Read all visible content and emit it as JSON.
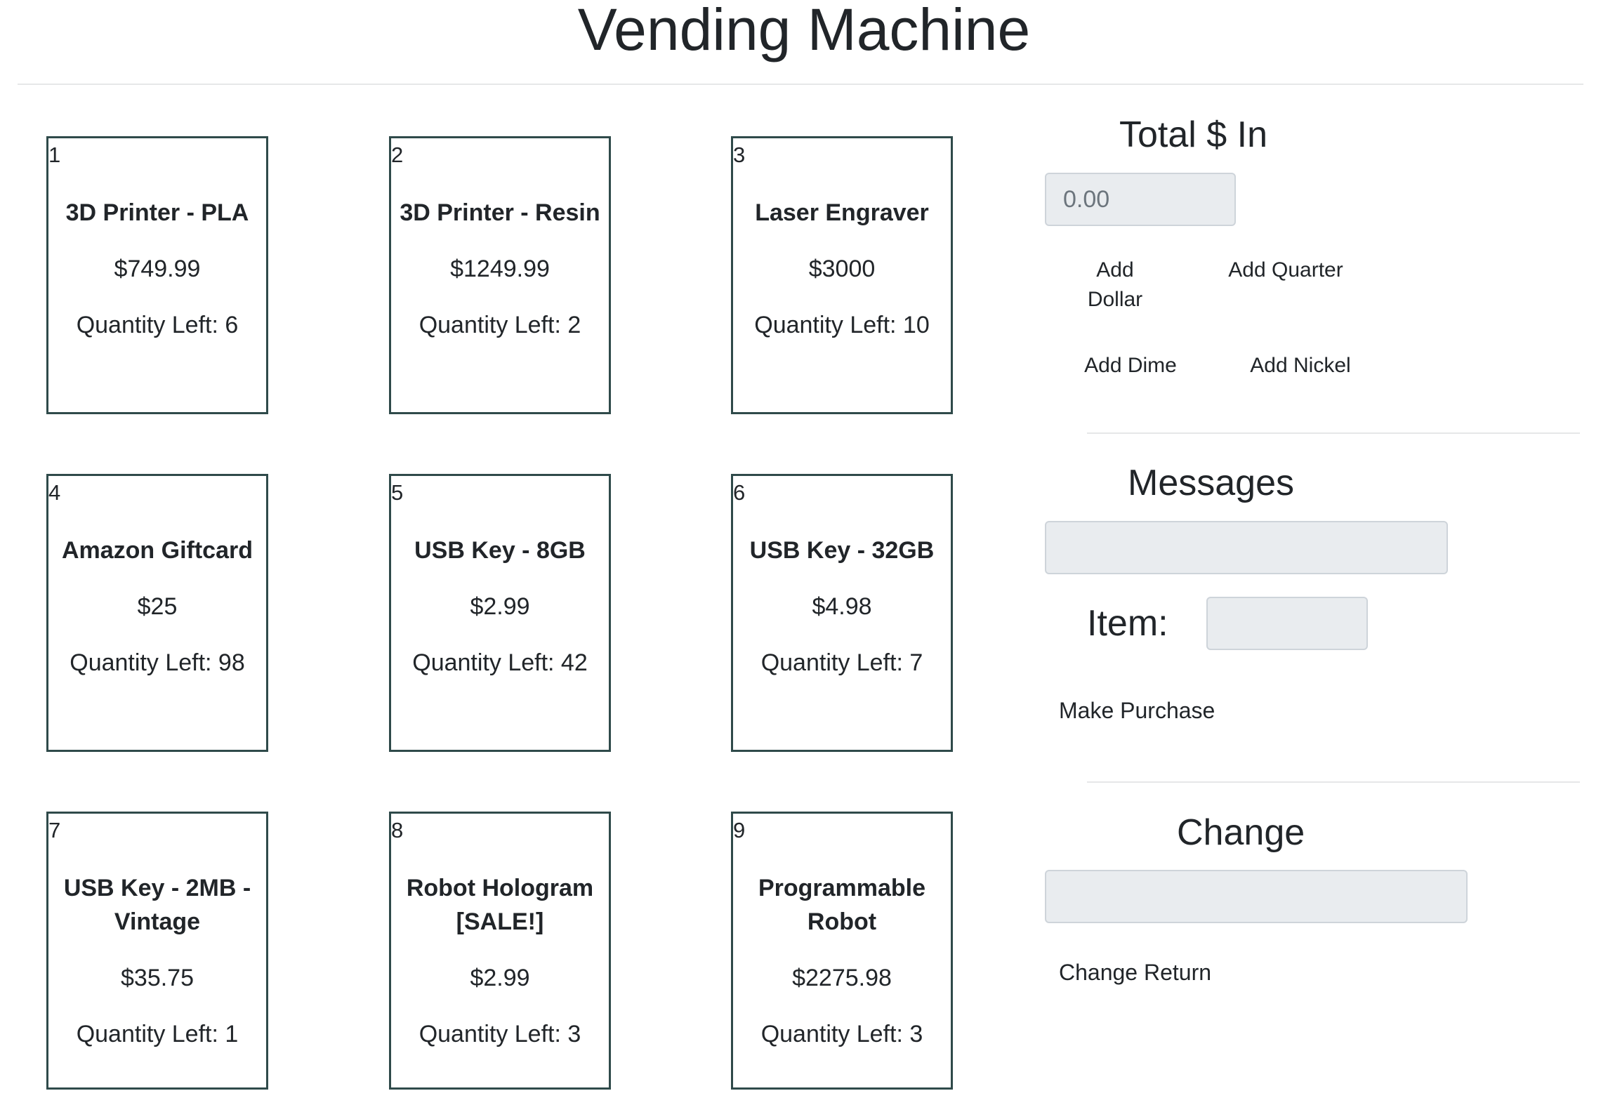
{
  "page": {
    "title": "Vending Machine"
  },
  "items": [
    {
      "number": "1",
      "name": "3D Printer - PLA",
      "price": "$749.99",
      "quantity": "Quantity Left: 6"
    },
    {
      "number": "2",
      "name": "3D Printer - Resin",
      "price": "$1249.99",
      "quantity": "Quantity Left: 2"
    },
    {
      "number": "3",
      "name": "Laser Engraver",
      "price": "$3000",
      "quantity": "Quantity Left: 10"
    },
    {
      "number": "4",
      "name": "Amazon Giftcard",
      "price": "$25",
      "quantity": "Quantity Left: 98"
    },
    {
      "number": "5",
      "name": "USB Key - 8GB",
      "price": "$2.99",
      "quantity": "Quantity Left: 42"
    },
    {
      "number": "6",
      "name": "USB Key - 32GB",
      "price": "$4.98",
      "quantity": "Quantity Left: 7"
    },
    {
      "number": "7",
      "name": "USB Key - 2MB - Vintage",
      "price": "$35.75",
      "quantity": "Quantity Left: 1"
    },
    {
      "number": "8",
      "name": "Robot Hologram [SALE!]",
      "price": "$2.99",
      "quantity": "Quantity Left: 3"
    },
    {
      "number": "9",
      "name": "Programmable Robot",
      "price": "$2275.98",
      "quantity": "Quantity Left: 3"
    }
  ],
  "money": {
    "heading": "Total $ In",
    "value": "0.00",
    "add_dollar": "Add Dollar",
    "add_quarter": "Add Quarter",
    "add_dime": "Add Dime",
    "add_nickel": "Add Nickel"
  },
  "messages": {
    "heading": "Messages",
    "value": "",
    "item_label": "Item:",
    "item_value": "",
    "purchase_label": "Make Purchase"
  },
  "change": {
    "heading": "Change",
    "value": "",
    "return_label": "Change Return"
  },
  "colors": {
    "card_border": "#2f4a4a",
    "field_bg": "#e9ecef",
    "text": "#212529"
  }
}
